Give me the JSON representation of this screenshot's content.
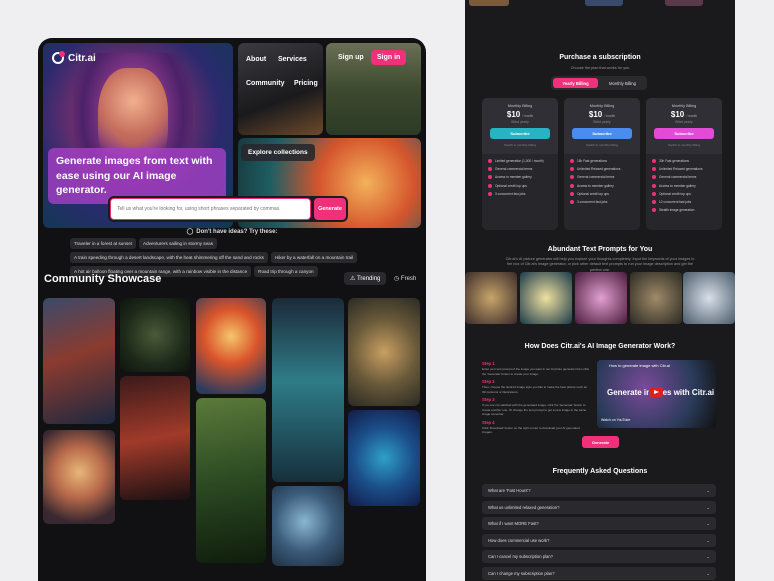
{
  "left": {
    "brand": "Citr.ai",
    "hero_caption": "Generate images from text with ease using our AI image generator.",
    "nav": {
      "about": "About",
      "services": "Services",
      "community": "Community",
      "pricing": "Pricing"
    },
    "auth": {
      "signup": "Sign up",
      "signin": "Sign in"
    },
    "explore": "Explore collections",
    "search": {
      "placeholder": "Tell us what you're looking for, using short phrases separated by commas.",
      "button": "Generate"
    },
    "ideas_title": "Don't have ideas? Try these:",
    "chips": [
      "Traveler in a forest at sunset",
      "Adventurers sailing in stormy seas",
      "A train speeding through a desert landscape, with the heat shimmering off the sand and rocks",
      "Hiker by a waterfall on a mountain trail",
      "A hot air balloon floating over a mountain range, with a rainbow visible in the distance",
      "Road trip through a canyon"
    ],
    "showcase": {
      "title": "Community Showcase",
      "tab_trending": "Trending",
      "tab_fresh": "Fresh"
    }
  },
  "right": {
    "purchase": {
      "title": "Purchase a subscription",
      "subtitle": "Choose the plan that works for you"
    },
    "billing": {
      "yearly": "Yearly Billing",
      "monthly": "Monthly Billing"
    },
    "plans": [
      {
        "name": "Monthly Billing",
        "price": "$10",
        "per": "/ month",
        "billed": "Billed yearly",
        "btn": "Subscribe",
        "note": "Switch to monthly billing",
        "color": "#27b3c4",
        "features": [
          "Limited generation (1,000 / month)",
          "General commercial terms",
          "Access to member gallery",
          "Optional credit top ups",
          "3 concurrent fast jobs"
        ]
      },
      {
        "name": "Monthly Billing",
        "price": "$10",
        "per": "/ month",
        "billed": "Billed yearly",
        "btn": "Subscribe",
        "note": "Switch to monthly billing",
        "color": "#4a8cf0",
        "features": [
          "15h Fast generations",
          "Unlimited Relaxed generations",
          "General commercial terms",
          "Access to member gallery",
          "Optional credit top ups",
          "3 concurrent fast jobs"
        ]
      },
      {
        "name": "Monthly Billing",
        "price": "$10",
        "per": "/ month",
        "billed": "Billed yearly",
        "btn": "Subscribe",
        "note": "Switch to monthly billing",
        "color": "#e34ad6",
        "features": [
          "30h Fast generations",
          "Unlimited Relaxed generations",
          "General commercial terms",
          "Access to member gallery",
          "Optional credit top ups",
          "12 concurrent fast jobs",
          "Stealth image generation"
        ]
      }
    ],
    "prompts": {
      "title": "Abundant Text Prompts for You",
      "subtitle": "Citr.ai's AI picture generator will help you explore your thoughts completely. Input the keywords of your images in the box of Citr.ai's image generator, or pick other default text prompts to run your image description and get the perfect one."
    },
    "how": {
      "title": "How Does Citr.ai's AI Image Generator Work?",
      "steps": [
        {
          "h": "Step 1",
          "t": "Enter your text prompt of the image you want in our AI photo generator then click the 'Generate' button to create your image."
        },
        {
          "h": "Step 2",
          "t": "Then, choose the desired image style you like to make the best picture such as 3D cartoons or illustrations."
        },
        {
          "h": "Step 3",
          "t": "If you are not satisfied with the generated image, click the 'Generate' button to create another one. Or change the text prompt to get a new image in the same image converter."
        },
        {
          "h": "Step 4",
          "t": "Click 'Download' button on the right corner to download your AI generated images."
        }
      ],
      "video_title": "How to generate image with Citr.ai",
      "video_big": "Generate images with Citr.ai",
      "watch": "Watch on YouTube",
      "generate": "Generate"
    },
    "faq": {
      "title": "Frequently Asked Questions",
      "items": [
        "What are 'Fast Hours'?",
        "What us unlimited relaxed generation?",
        "What if I want MORE Fast?",
        "How does commercial use work?",
        "Can I cancel my subscription plan?",
        "Can I change my subscription plan?"
      ]
    }
  }
}
